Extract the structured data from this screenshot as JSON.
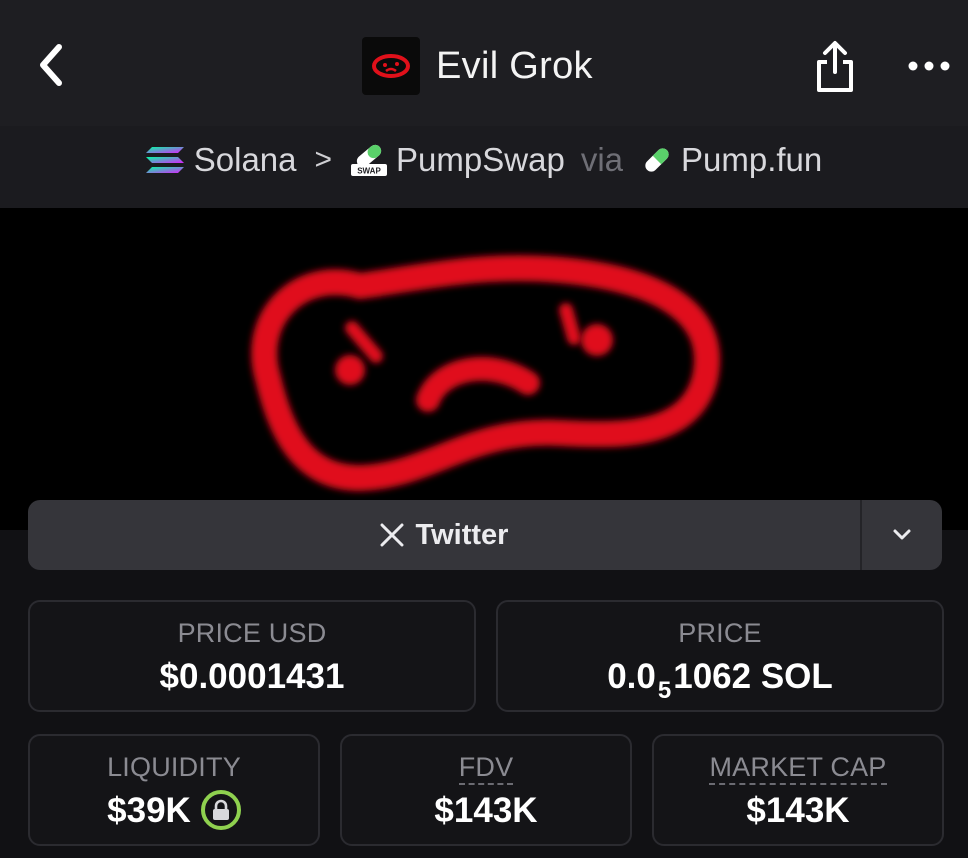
{
  "header": {
    "title": "Evil Grok",
    "back_icon": "chevron-left-icon",
    "share_icon": "share-icon",
    "more_icon": "more-dots-icon"
  },
  "breadcrumb": {
    "chain": "Solana",
    "dex": "PumpSwap",
    "via": "via",
    "launchpad": "Pump.fun",
    "separator": ">"
  },
  "social": {
    "twitter_label": "Twitter",
    "twitter_icon": "x-logo-icon",
    "dropdown_icon": "chevron-down-icon"
  },
  "stats": {
    "price_usd": {
      "label": "PRICE USD",
      "value": "$0.0001431"
    },
    "price": {
      "label": "PRICE",
      "prefix": "0.0",
      "subscript": "5",
      "suffix": "1062 SOL"
    },
    "liquidity": {
      "label": "LIQUIDITY",
      "value": "$39K"
    },
    "fdv": {
      "label": "FDV",
      "value": "$143K"
    },
    "market_cap": {
      "label": "MARKET CAP",
      "value": "$143K"
    }
  },
  "colors": {
    "accent_red": "#e0101a",
    "lock_green": "#8fd14f",
    "background": "#111114"
  }
}
